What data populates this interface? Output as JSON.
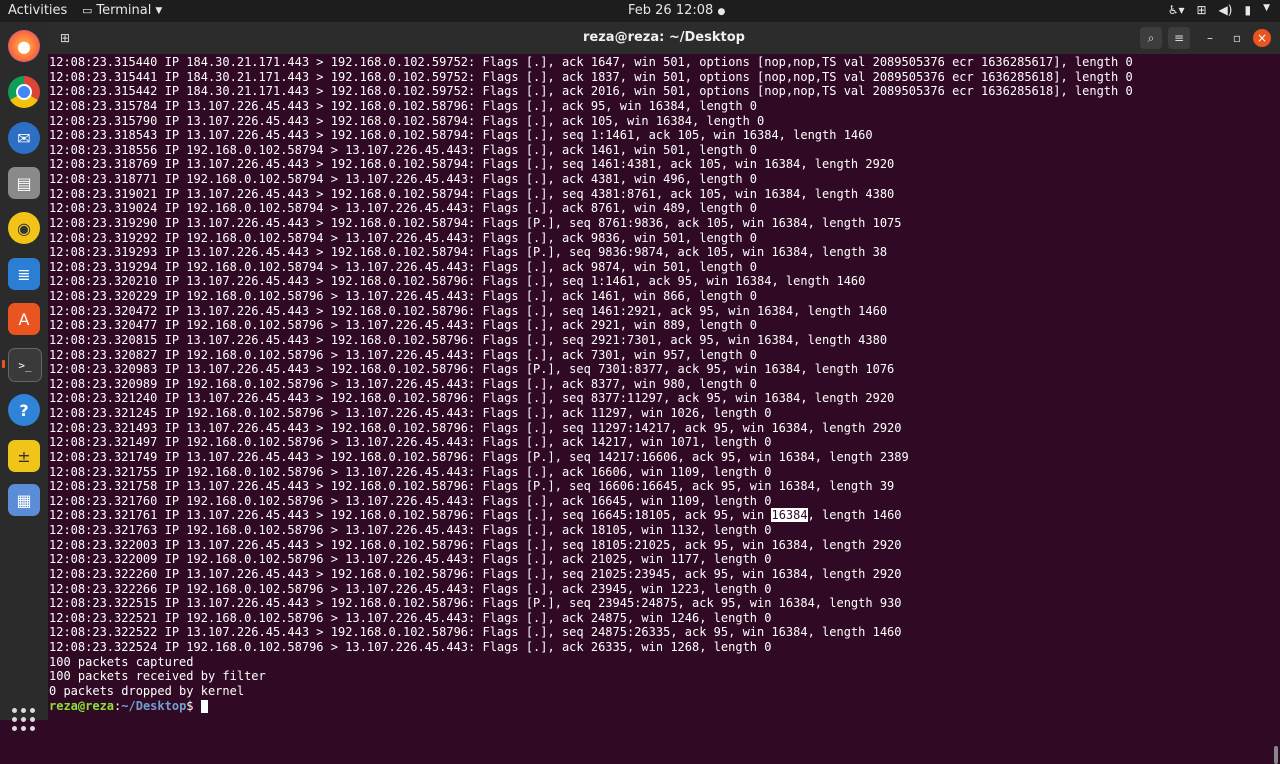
{
  "topbar": {
    "activities": "Activities",
    "app_name": "Terminal",
    "clock": "Feb 26  12:08"
  },
  "window": {
    "title": "reza@reza: ~/Desktop"
  },
  "dock": {
    "items": [
      "firefox-icon",
      "chrome-icon",
      "thunderbird-icon",
      "files-icon",
      "rhythmbox-icon",
      "writer-icon",
      "software-icon",
      "terminal-icon",
      "help-icon",
      "calc-icon",
      "app-icon"
    ]
  },
  "terminal": {
    "lines": [
      "12:08:23.315440 IP 184.30.21.171.443 > 192.168.0.102.59752: Flags [.], ack 1647, win 501, options [nop,nop,TS val 2089505376 ecr 1636285617], length 0",
      "12:08:23.315441 IP 184.30.21.171.443 > 192.168.0.102.59752: Flags [.], ack 1837, win 501, options [nop,nop,TS val 2089505376 ecr 1636285618], length 0",
      "12:08:23.315442 IP 184.30.21.171.443 > 192.168.0.102.59752: Flags [.], ack 2016, win 501, options [nop,nop,TS val 2089505376 ecr 1636285618], length 0",
      "12:08:23.315784 IP 13.107.226.45.443 > 192.168.0.102.58796: Flags [.], ack 95, win 16384, length 0",
      "12:08:23.315790 IP 13.107.226.45.443 > 192.168.0.102.58794: Flags [.], ack 105, win 16384, length 0",
      "12:08:23.318543 IP 13.107.226.45.443 > 192.168.0.102.58794: Flags [.], seq 1:1461, ack 105, win 16384, length 1460",
      "12:08:23.318556 IP 192.168.0.102.58794 > 13.107.226.45.443: Flags [.], ack 1461, win 501, length 0",
      "12:08:23.318769 IP 13.107.226.45.443 > 192.168.0.102.58794: Flags [.], seq 1461:4381, ack 105, win 16384, length 2920",
      "12:08:23.318771 IP 192.168.0.102.58794 > 13.107.226.45.443: Flags [.], ack 4381, win 496, length 0",
      "12:08:23.319021 IP 13.107.226.45.443 > 192.168.0.102.58794: Flags [.], seq 4381:8761, ack 105, win 16384, length 4380",
      "12:08:23.319024 IP 192.168.0.102.58794 > 13.107.226.45.443: Flags [.], ack 8761, win 489, length 0",
      "12:08:23.319290 IP 13.107.226.45.443 > 192.168.0.102.58794: Flags [P.], seq 8761:9836, ack 105, win 16384, length 1075",
      "12:08:23.319292 IP 192.168.0.102.58794 > 13.107.226.45.443: Flags [.], ack 9836, win 501, length 0",
      "12:08:23.319293 IP 13.107.226.45.443 > 192.168.0.102.58794: Flags [P.], seq 9836:9874, ack 105, win 16384, length 38",
      "12:08:23.319294 IP 192.168.0.102.58794 > 13.107.226.45.443: Flags [.], ack 9874, win 501, length 0",
      "12:08:23.320210 IP 13.107.226.45.443 > 192.168.0.102.58796: Flags [.], seq 1:1461, ack 95, win 16384, length 1460",
      "12:08:23.320229 IP 192.168.0.102.58796 > 13.107.226.45.443: Flags [.], ack 1461, win 866, length 0",
      "12:08:23.320472 IP 13.107.226.45.443 > 192.168.0.102.58796: Flags [.], seq 1461:2921, ack 95, win 16384, length 1460",
      "12:08:23.320477 IP 192.168.0.102.58796 > 13.107.226.45.443: Flags [.], ack 2921, win 889, length 0",
      "12:08:23.320815 IP 13.107.226.45.443 > 192.168.0.102.58796: Flags [.], seq 2921:7301, ack 95, win 16384, length 4380",
      "12:08:23.320827 IP 192.168.0.102.58796 > 13.107.226.45.443: Flags [.], ack 7301, win 957, length 0",
      "12:08:23.320983 IP 13.107.226.45.443 > 192.168.0.102.58796: Flags [P.], seq 7301:8377, ack 95, win 16384, length 1076",
      "12:08:23.320989 IP 192.168.0.102.58796 > 13.107.226.45.443: Flags [.], ack 8377, win 980, length 0",
      "12:08:23.321240 IP 13.107.226.45.443 > 192.168.0.102.58796: Flags [.], seq 8377:11297, ack 95, win 16384, length 2920",
      "12:08:23.321245 IP 192.168.0.102.58796 > 13.107.226.45.443: Flags [.], ack 11297, win 1026, length 0",
      "12:08:23.321493 IP 13.107.226.45.443 > 192.168.0.102.58796: Flags [.], seq 11297:14217, ack 95, win 16384, length 2920",
      "12:08:23.321497 IP 192.168.0.102.58796 > 13.107.226.45.443: Flags [.], ack 14217, win 1071, length 0",
      "12:08:23.321749 IP 13.107.226.45.443 > 192.168.0.102.58796: Flags [P.], seq 14217:16606, ack 95, win 16384, length 2389",
      "12:08:23.321755 IP 192.168.0.102.58796 > 13.107.226.45.443: Flags [.], ack 16606, win 1109, length 0",
      "12:08:23.321758 IP 13.107.226.45.443 > 192.168.0.102.58796: Flags [P.], seq 16606:16645, ack 95, win 16384, length 39",
      "12:08:23.321760 IP 192.168.0.102.58796 > 13.107.226.45.443: Flags [.], ack 16645, win 1109, length 0",
      "SELECTED_LINE",
      "12:08:23.321763 IP 192.168.0.102.58796 > 13.107.226.45.443: Flags [.], ack 18105, win 1132, length 0",
      "12:08:23.322003 IP 13.107.226.45.443 > 192.168.0.102.58796: Flags [.], seq 18105:21025, ack 95, win 16384, length 2920",
      "12:08:23.322009 IP 192.168.0.102.58796 > 13.107.226.45.443: Flags [.], ack 21025, win 1177, length 0",
      "12:08:23.322260 IP 13.107.226.45.443 > 192.168.0.102.58796: Flags [.], seq 21025:23945, ack 95, win 16384, length 2920",
      "12:08:23.322266 IP 192.168.0.102.58796 > 13.107.226.45.443: Flags [.], ack 23945, win 1223, length 0",
      "12:08:23.322515 IP 13.107.226.45.443 > 192.168.0.102.58796: Flags [P.], seq 23945:24875, ack 95, win 16384, length 930",
      "12:08:23.322521 IP 192.168.0.102.58796 > 13.107.226.45.443: Flags [.], ack 24875, win 1246, length 0",
      "12:08:23.322522 IP 13.107.226.45.443 > 192.168.0.102.58796: Flags [.], seq 24875:26335, ack 95, win 16384, length 1460",
      "12:08:23.322524 IP 192.168.0.102.58796 > 13.107.226.45.443: Flags [.], ack 26335, win 1268, length 0",
      "100 packets captured",
      "100 packets received by filter",
      "0 packets dropped by kernel"
    ],
    "selected_line": {
      "before": "12:08:23.321761 IP 13.107.226.45.443 > 192.168.0.102.58796: Flags [.], seq 16645:18105, ack 95, win ",
      "selected": "16384",
      "after": ", length 1460"
    },
    "prompt": {
      "user_host": "reza@reza",
      "sep": ":",
      "path": "~/Desktop",
      "symbol": "$ "
    }
  }
}
